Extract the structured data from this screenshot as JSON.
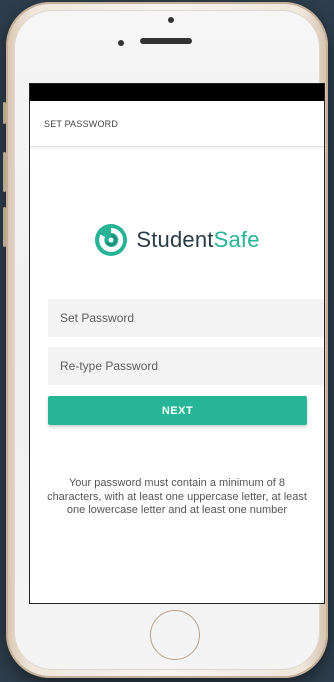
{
  "app_bar": {
    "title": "SET PASSWORD"
  },
  "logo": {
    "word1": "Student",
    "word2": "Safe",
    "icon": "studentsafe-logo-icon",
    "brand_color": "#26b396",
    "dark_color": "#2a3b48"
  },
  "form": {
    "password_placeholder": "Set Password",
    "password_value": "",
    "retype_placeholder": "Re-type Password",
    "retype_value": "",
    "next_label": "NEXT"
  },
  "helper_text": "Your password must contain a minimum of 8 characters, with at least one uppercase letter, at least one lowercase letter and at least one number",
  "colors": {
    "accent": "#26b596",
    "background": "#2e3d4b",
    "status_bar": "#000000"
  }
}
